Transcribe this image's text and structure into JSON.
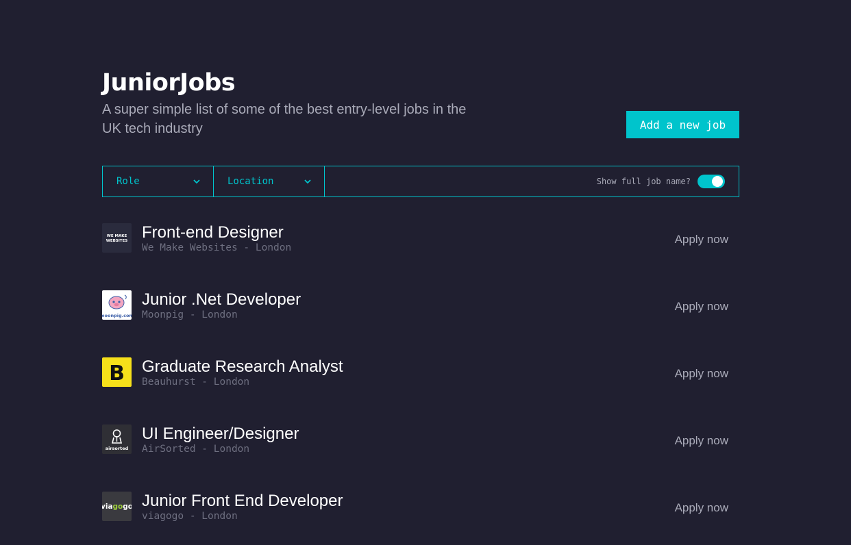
{
  "header": {
    "title": "JuniorJobs",
    "subtitle": "A super simple list of some of the best entry-level jobs in the UK tech industry",
    "add_button": "Add a new job"
  },
  "filters": {
    "role": "Role",
    "location": "Location",
    "toggle_label": "Show full job name?",
    "toggle_on": true
  },
  "colors": {
    "background": "#201f30",
    "accent": "#00c4cc"
  },
  "jobs": [
    {
      "title": "Front-end Designer",
      "meta": "We Make Websites - London",
      "apply": "Apply now",
      "logo": "we-make-websites-logo",
      "logo_text": "WE MAKE WEBSITES"
    },
    {
      "title": "Junior .Net Developer",
      "meta": "Moonpig - London",
      "apply": "Apply now",
      "logo": "moonpig-logo",
      "logo_text": "moonpig.com"
    },
    {
      "title": "Graduate Research Analyst",
      "meta": "Beauhurst - London",
      "apply": "Apply now",
      "logo": "beauhurst-logo",
      "logo_text": "B"
    },
    {
      "title": "UI Engineer/Designer",
      "meta": "AirSorted - London",
      "apply": "Apply now",
      "logo": "airsorted-logo",
      "logo_text": "airsorted"
    },
    {
      "title": "Junior Front End Developer",
      "meta": "viagogo - London",
      "apply": "Apply now",
      "logo": "viagogo-logo",
      "logo_text": "viagogo"
    }
  ]
}
